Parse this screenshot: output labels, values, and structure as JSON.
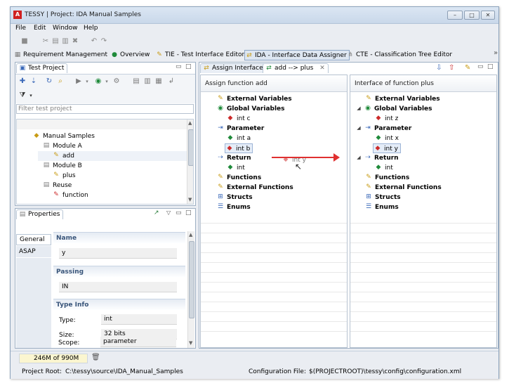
{
  "window": {
    "title": "TESSY | Project: IDA Manual Samples",
    "app_icon_letter": "A"
  },
  "menu": [
    "File",
    "Edit",
    "Window",
    "Help"
  ],
  "perspectives": [
    {
      "label": "Requirement Management",
      "icon": "requirements-icon"
    },
    {
      "label": "Overview",
      "icon": "globe-icon"
    },
    {
      "label": "TIE - Test Interface Editor",
      "icon": "tie-icon"
    },
    {
      "label": "IDA - Interface Data Assigner",
      "icon": "ida-icon",
      "active": true
    },
    {
      "label": "CTE - Classification Tree Editor",
      "icon": "cte-icon"
    }
  ],
  "perspectives_more": "»",
  "test_project": {
    "tab_label": "Test Project",
    "filter_placeholder": "Filter test project",
    "tree": [
      {
        "label": "Manual Samples",
        "level": 0
      },
      {
        "label": "Module A",
        "level": 1
      },
      {
        "label": "add",
        "level": 2,
        "selected": true
      },
      {
        "label": "Module B",
        "level": 1
      },
      {
        "label": "plus",
        "level": 2
      },
      {
        "label": "Reuse",
        "level": 1
      },
      {
        "label": "function",
        "level": 2
      }
    ]
  },
  "properties": {
    "tab_label": "Properties",
    "side_tabs": [
      "General",
      "ASAP"
    ],
    "name_header": "Name",
    "name_value": "y",
    "passing_header": "Passing",
    "passing_value": "IN",
    "typeinfo_header": "Type Info",
    "type_label": "Type:",
    "type_value": "int",
    "size_label": "Size:",
    "size_value": "32 bits",
    "scope_label": "Scope:",
    "scope_value": "parameter"
  },
  "assign": {
    "tab1_label": "Assign Interface",
    "tab2_label": "add --> plus",
    "left_header": "Assign function add",
    "right_header": "Interface of function plus",
    "left_tree": {
      "external_variables": "External Variables",
      "global_variables": "Global Variables",
      "int_c": "int c",
      "parameter": "Parameter",
      "int_a": "int a",
      "int_b": "int b",
      "return": "Return",
      "return_int": "int",
      "functions": "Functions",
      "external_functions": "External Functions",
      "structs": "Structs",
      "enums": "Enums"
    },
    "drag_ghost": "int y",
    "right_tree": {
      "external_variables": "External Variables",
      "global_variables": "Global Variables",
      "int_z": "int z",
      "parameter": "Parameter",
      "int_x": "int x",
      "int_y": "int y",
      "return": "Return",
      "return_int": "int",
      "functions": "Functions",
      "external_functions": "External Functions",
      "structs": "Structs",
      "enums": "Enums"
    }
  },
  "status": {
    "memory": "246M of 990M",
    "project_root_label": "Project Root:",
    "project_root_value": "C:\\tessy\\source\\IDA_Manual_Samples",
    "config_label": "Configuration File:",
    "config_value": "$(PROJECTROOT)\\tessy\\config\\configuration.xml"
  },
  "colors": {
    "accent": "#3a68b8",
    "drag_arrow": "#e03030",
    "selection": "#dde8f6"
  }
}
